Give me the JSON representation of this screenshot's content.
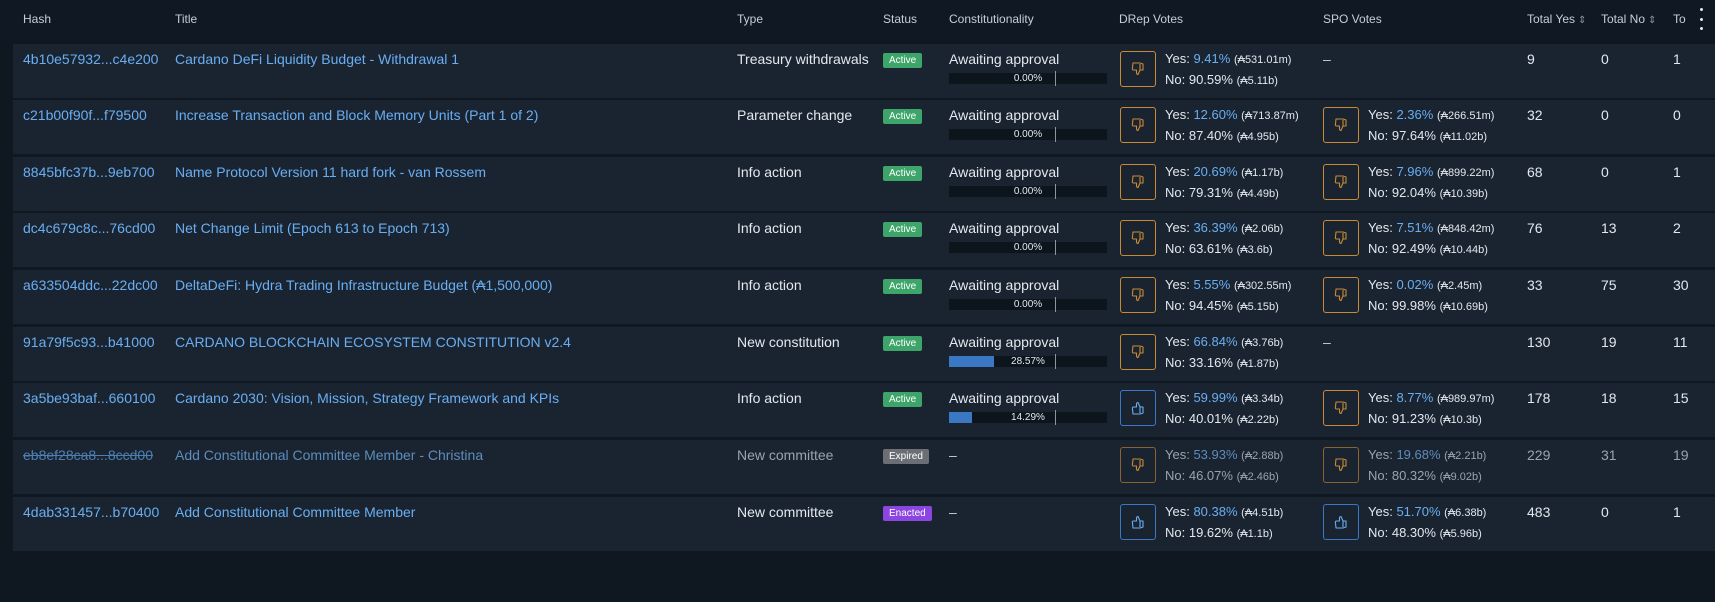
{
  "colors": {
    "accent": "#69aef2",
    "active": "#3ea56a",
    "expired": "#6b6f75",
    "enacted": "#8b45e0",
    "vote_no_border": "#c98a36",
    "vote_yes_border": "#3b78c4"
  },
  "columns": {
    "hash": "Hash",
    "title": "Title",
    "type": "Type",
    "status": "Status",
    "constitutionality": "Constitutionality",
    "drep": "DRep Votes",
    "spo": "SPO Votes",
    "total_yes": "Total Yes",
    "total_no": "Total No",
    "total_abstain": "To"
  },
  "rows": [
    {
      "hash": "4b10e57932...c4e200",
      "title": "Cardano DeFi Liquidity Budget - Withdrawal 1",
      "type": "Treasury withdrawals",
      "status": "Active",
      "const": "Awaiting approval",
      "progress": 0.0,
      "progress_label": "0.00%",
      "drep": {
        "icon": "thumbs-down-icon",
        "yes_pct": "9.41%",
        "yes_amt": "(₳531.01m)",
        "no_pct": "90.59%",
        "no_amt": "(₳5.11b)"
      },
      "spo": null,
      "spo_dash": "–",
      "total_yes": "9",
      "total_no": "0",
      "total_abstain": "1"
    },
    {
      "hash": "c21b00f90f...f79500",
      "title": "Increase Transaction and Block Memory Units (Part 1 of 2)",
      "type": "Parameter change",
      "status": "Active",
      "const": "Awaiting approval",
      "progress": 0.0,
      "progress_label": "0.00%",
      "drep": {
        "icon": "thumbs-down-icon",
        "yes_pct": "12.60%",
        "yes_amt": "(₳713.87m)",
        "no_pct": "87.40%",
        "no_amt": "(₳4.95b)"
      },
      "spo": {
        "icon": "thumbs-down-icon",
        "yes_pct": "2.36%",
        "yes_amt": "(₳266.51m)",
        "no_pct": "97.64%",
        "no_amt": "(₳11.02b)"
      },
      "total_yes": "32",
      "total_no": "0",
      "total_abstain": "0"
    },
    {
      "hash": "8845bfc37b...9eb700",
      "title": "Name Protocol Version 11 hard fork - van Rossem",
      "type": "Info action",
      "status": "Active",
      "const": "Awaiting approval",
      "progress": 0.0,
      "progress_label": "0.00%",
      "drep": {
        "icon": "thumbs-down-icon",
        "yes_pct": "20.69%",
        "yes_amt": "(₳1.17b)",
        "no_pct": "79.31%",
        "no_amt": "(₳4.49b)"
      },
      "spo": {
        "icon": "thumbs-down-icon",
        "yes_pct": "7.96%",
        "yes_amt": "(₳899.22m)",
        "no_pct": "92.04%",
        "no_amt": "(₳10.39b)"
      },
      "total_yes": "68",
      "total_no": "0",
      "total_abstain": "1"
    },
    {
      "hash": "dc4c679c8c...76cd00",
      "title": "Net Change Limit (Epoch 613 to Epoch 713)",
      "type": "Info action",
      "status": "Active",
      "const": "Awaiting approval",
      "progress": 0.0,
      "progress_label": "0.00%",
      "drep": {
        "icon": "thumbs-down-icon",
        "yes_pct": "36.39%",
        "yes_amt": "(₳2.06b)",
        "no_pct": "63.61%",
        "no_amt": "(₳3.6b)"
      },
      "spo": {
        "icon": "thumbs-down-icon",
        "yes_pct": "7.51%",
        "yes_amt": "(₳848.42m)",
        "no_pct": "92.49%",
        "no_amt": "(₳10.44b)"
      },
      "total_yes": "76",
      "total_no": "13",
      "total_abstain": "2"
    },
    {
      "hash": "a633504ddc...22dc00",
      "title": "DeltaDeFi: Hydra Trading Infrastructure Budget (₳1,500,000)",
      "type": "Info action",
      "status": "Active",
      "const": "Awaiting approval",
      "progress": 0.0,
      "progress_label": "0.00%",
      "drep": {
        "icon": "thumbs-down-icon",
        "yes_pct": "5.55%",
        "yes_amt": "(₳302.55m)",
        "no_pct": "94.45%",
        "no_amt": "(₳5.15b)"
      },
      "spo": {
        "icon": "thumbs-down-icon",
        "yes_pct": "0.02%",
        "yes_amt": "(₳2.45m)",
        "no_pct": "99.98%",
        "no_amt": "(₳10.69b)"
      },
      "total_yes": "33",
      "total_no": "75",
      "total_abstain": "30"
    },
    {
      "hash": "91a79f5c93...b41000",
      "title": "CARDANO BLOCKCHAIN ECOSYSTEM CONSTITUTION v2.4",
      "type": "New constitution",
      "status": "Active",
      "const": "Awaiting approval",
      "progress": 0.2857,
      "progress_label": "28.57%",
      "drep": {
        "icon": "thumbs-down-icon",
        "yes_pct": "66.84%",
        "yes_amt": "(₳3.76b)",
        "no_pct": "33.16%",
        "no_amt": "(₳1.87b)"
      },
      "spo": null,
      "spo_dash": "–",
      "total_yes": "130",
      "total_no": "19",
      "total_abstain": "11"
    },
    {
      "hash": "3a5be93baf...660100",
      "title": "Cardano 2030: Vision, Mission, Strategy Framework and KPIs",
      "type": "Info action",
      "status": "Active",
      "const": "Awaiting approval",
      "progress": 0.1429,
      "progress_label": "14.29%",
      "drep": {
        "icon": "thumbs-up-icon",
        "yes_pct": "59.99%",
        "yes_amt": "(₳3.34b)",
        "no_pct": "40.01%",
        "no_amt": "(₳2.22b)"
      },
      "spo": {
        "icon": "thumbs-down-icon",
        "yes_pct": "8.77%",
        "yes_amt": "(₳989.97m)",
        "no_pct": "91.23%",
        "no_amt": "(₳10.3b)"
      },
      "total_yes": "178",
      "total_no": "18",
      "total_abstain": "15"
    },
    {
      "hash": "eb8ef28ca8...8ccd00",
      "title": "Add Constitutional Committee Member - Christina",
      "type": "New committee",
      "status": "Expired",
      "const_dash": "–",
      "drep": {
        "icon": "thumbs-down-icon",
        "yes_pct": "53.93%",
        "yes_amt": "(₳2.88b)",
        "no_pct": "46.07%",
        "no_amt": "(₳2.46b)"
      },
      "spo": {
        "icon": "thumbs-down-icon",
        "yes_pct": "19.68%",
        "yes_amt": "(₳2.21b)",
        "no_pct": "80.32%",
        "no_amt": "(₳9.02b)"
      },
      "total_yes": "229",
      "total_no": "31",
      "total_abstain": "19"
    },
    {
      "hash": "4dab331457...b70400",
      "title": "Add Constitutional Committee Member",
      "type": "New committee",
      "status": "Enacted",
      "const_dash": "–",
      "drep": {
        "icon": "thumbs-up-icon",
        "yes_pct": "80.38%",
        "yes_amt": "(₳4.51b)",
        "no_pct": "19.62%",
        "no_amt": "(₳1.1b)"
      },
      "spo": {
        "icon": "thumbs-up-icon",
        "yes_pct": "51.70%",
        "yes_amt": "(₳6.38b)",
        "no_pct": "48.30%",
        "no_amt": "(₳5.96b)"
      },
      "total_yes": "483",
      "total_no": "0",
      "total_abstain": "1"
    }
  ]
}
